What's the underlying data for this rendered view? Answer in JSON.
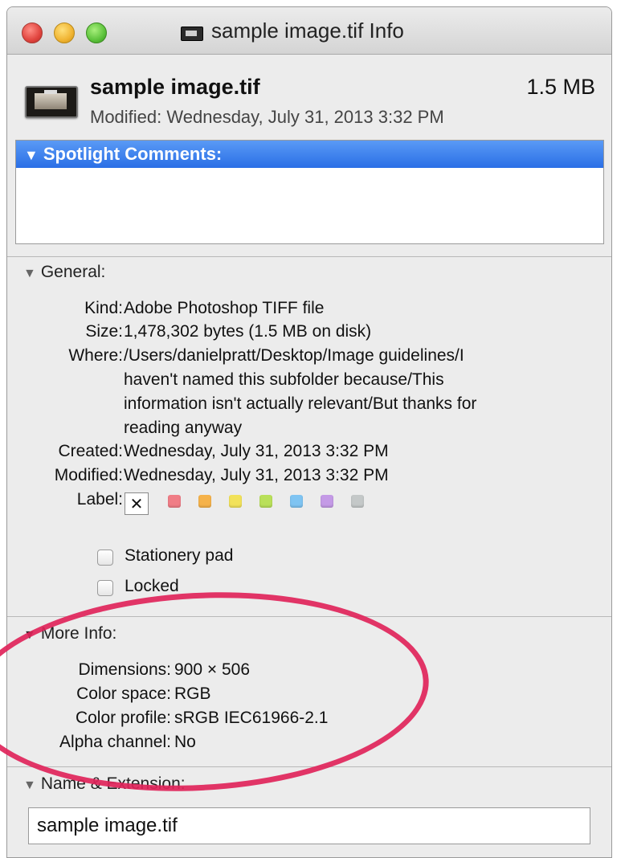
{
  "window": {
    "title": "sample image.tif Info"
  },
  "header": {
    "file_name": "sample image.tif",
    "file_size": "1.5 MB",
    "modified": "Modified: Wednesday, July 31, 2013 3:32 PM"
  },
  "spotlight": {
    "label": "Spotlight Comments:",
    "value": ""
  },
  "general": {
    "label": "General:",
    "kind_label": "Kind:",
    "kind": "Adobe Photoshop TIFF file",
    "size_label": "Size:",
    "size": "1,478,302 bytes (1.5 MB on disk)",
    "where_label": "Where:",
    "where_lines": [
      "/Users/danielpratt/Desktop/Image guidelines/I",
      "haven't named this subfolder because/This",
      "information isn't actually relevant/But thanks for",
      "reading anyway"
    ],
    "created_label": "Created:",
    "created": "Wednesday, July 31, 2013 3:32 PM",
    "modified_label": "Modified:",
    "modified": "Wednesday, July 31, 2013 3:32 PM",
    "label_label": "Label:",
    "label_none": "✕",
    "label_colors": [
      "#f07d86",
      "#f5b24a",
      "#f2e25a",
      "#b9e05a",
      "#7fc4f2",
      "#c49ae6",
      "#c4c8c8"
    ],
    "stationery_pad": "Stationery pad",
    "locked": "Locked"
  },
  "more_info": {
    "label": "More Info:",
    "dimensions_label": "Dimensions:",
    "dimensions": "900 × 506",
    "color_space_label": "Color space:",
    "color_space": "RGB",
    "color_profile_label": "Color profile:",
    "color_profile": "sRGB IEC61966-2.1",
    "alpha_channel_label": "Alpha channel:",
    "alpha_channel": "No"
  },
  "name_extension": {
    "label": "Name & Extension:",
    "value": "sample image.tif"
  }
}
